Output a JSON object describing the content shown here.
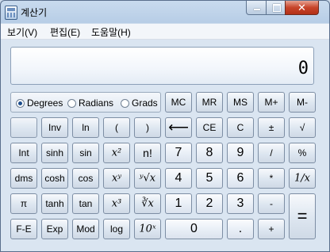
{
  "window": {
    "title": "계산기"
  },
  "window_controls": {
    "close": "✕"
  },
  "menu": {
    "items": [
      "보기(V)",
      "편집(E)",
      "도움말(H)"
    ]
  },
  "display": {
    "value": "0"
  },
  "angle_modes": {
    "options": [
      "Degrees",
      "Radians",
      "Grads"
    ],
    "selected": "Degrees"
  },
  "memory": {
    "mc": "MC",
    "mr": "MR",
    "ms": "MS",
    "mplus": "M+",
    "mminus": "M-"
  },
  "sci": {
    "inv": "Inv",
    "ln": "ln",
    "lparen": "(",
    "rparen": ")",
    "int": "Int",
    "sinh": "sinh",
    "sin": "sin",
    "x2": "x²",
    "nfact": "n!",
    "dms": "dms",
    "cosh": "cosh",
    "cos": "cos",
    "xy": "xʸ",
    "yroot": "ʸ√x",
    "pi": "π",
    "tanh": "tanh",
    "tan": "tan",
    "x3": "x³",
    "cuberoot": "∛x",
    "fe": "F-E",
    "exp": "Exp",
    "mod": "Mod",
    "log": "log",
    "ten_x": "10ˣ"
  },
  "edit": {
    "backspace": "⟵",
    "ce": "CE",
    "c": "C",
    "negate": "±",
    "sqrt": "√"
  },
  "digits": {
    "d0": "0",
    "d1": "1",
    "d2": "2",
    "d3": "3",
    "d4": "4",
    "d5": "5",
    "d6": "6",
    "d7": "7",
    "d8": "8",
    "d9": "9",
    "dot": "."
  },
  "ops": {
    "divide": "/",
    "percent": "%",
    "multiply": "*",
    "reciprocal": "1/x",
    "subtract": "-",
    "add": "+",
    "equals": "="
  }
}
